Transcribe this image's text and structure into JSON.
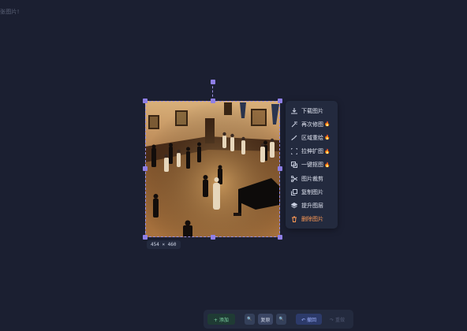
{
  "header": {
    "label": "张图片!"
  },
  "image": {
    "size_label": "454 × 460"
  },
  "context_menu": {
    "items": [
      {
        "label": "下载图片",
        "icon": "download-icon",
        "hot": false
      },
      {
        "label": "再次修图",
        "icon": "magic-wand-icon",
        "hot": true
      },
      {
        "label": "区域重绘",
        "icon": "brush-icon",
        "hot": true
      },
      {
        "label": "拉伸扩图",
        "icon": "expand-icon",
        "hot": true
      },
      {
        "label": "一键抠图",
        "icon": "cutout-icon",
        "hot": true
      },
      {
        "label": "图片裁剪",
        "icon": "scissors-icon",
        "hot": false
      },
      {
        "label": "复制图片",
        "icon": "copy-icon",
        "hot": false
      },
      {
        "label": "提升图层",
        "icon": "layers-icon",
        "hot": false
      },
      {
        "label": "删除图片",
        "icon": "trash-icon",
        "hot": false,
        "danger": true
      }
    ],
    "hot_badge": "🔥"
  },
  "toolbar": {
    "add_label": "+ 添加",
    "zoom_out_label": "🔍",
    "reset_label": "复原",
    "zoom_in_label": "🔍",
    "undo_label": "↶ 撤回",
    "redo_label": "↷ 重做"
  },
  "colors": {
    "background": "#1b1f31",
    "panel": "#232a3e",
    "accent": "#8f7fe6",
    "danger": "#ff9a55"
  }
}
